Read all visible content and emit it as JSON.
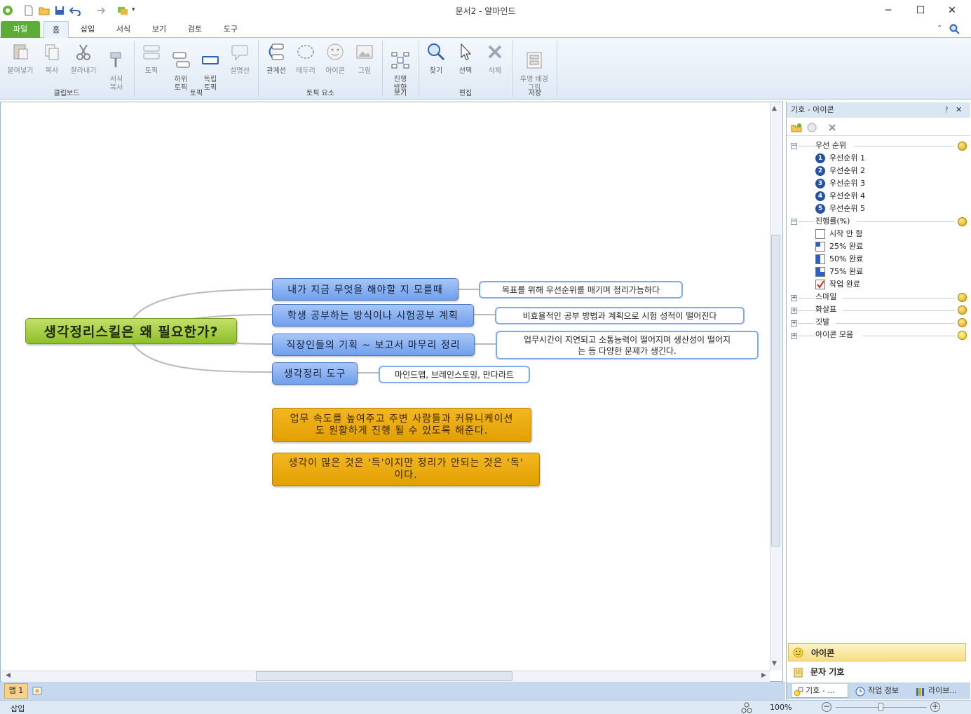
{
  "window": {
    "title": "문서2 - 알마인드",
    "minimize": "─",
    "maximize": "☐",
    "close": "✕"
  },
  "tabs": {
    "file": "파일",
    "home": "홈",
    "insert": "삽입",
    "format": "서식",
    "view": "보기",
    "review": "검토",
    "tools": "도구"
  },
  "ribbon": {
    "paste": "붙여넣기",
    "copy": "복사",
    "cut": "잘라내기",
    "format_copy": "서식\n복사",
    "clipboard_group": "클립보드",
    "topic": "토픽",
    "sub_topic": "하위\n토픽",
    "float_topic": "독립\n토픽",
    "callout": "설명선",
    "topic_group": "토픽",
    "relation": "관계선",
    "boundary": "테두리",
    "icon": "아이콘",
    "image": "그림",
    "topic_element_group": "토픽 요소",
    "direction": "진행\n방향",
    "view_group": "보기",
    "find": "찾기",
    "select": "선택",
    "delete": "삭제",
    "edit_group": "편집",
    "transparent_bg": "투명 배경\n그림",
    "save_group": "저장"
  },
  "mindmap": {
    "central": "생각정리스킬은 왜 필요한가?",
    "branches": [
      {
        "main": "내가 지금 무엇을 해야할 지 모를때",
        "sub": "목표를 위해 우선순위를 매기며 정리가능하다"
      },
      {
        "main": "학생 공부하는 방식이나 시험공부 계획",
        "sub": "비효율적인 공부 방법과 계획으로 시험 성적이 떨어진다"
      },
      {
        "main": "직장인들의 기획 ~ 보고서 마무리 정리",
        "sub": "업무시간이 지연되고 소통능력이 떨어지며 생산성이 떨어지\n는 등 다양한 문제가 생긴다."
      },
      {
        "main": "생각정리 도구",
        "sub": "마인드맵, 브레인스토밍, 만다라트"
      }
    ],
    "floating": [
      "업무 속도를 높여주고 주변 사람들과 커뮤니케이션\n도 원활하게 진행 될 수 있도록 해준다.",
      "생각이 많은 것은 '득'이지만 정리가 안되는 것은 '독'\n이다."
    ]
  },
  "page_tabs": {
    "page1": "맵 1"
  },
  "status": {
    "mode": "삽입",
    "zoom": "100%"
  },
  "panel": {
    "title": "기호 - 아이콘",
    "pin": "ᚹ",
    "close": "✕",
    "priority": {
      "label": "우선 순위",
      "items": [
        "우선순위 1",
        "우선순위 2",
        "우선순위 3",
        "우선순위 4",
        "우선순위 5"
      ],
      "numbers": [
        "1",
        "2",
        "3",
        "4",
        "5"
      ]
    },
    "progress": {
      "label": "진행률(%)",
      "items": [
        "시작 안 함",
        "25% 완료",
        "50% 완료",
        "75% 완료",
        "작업 완료"
      ]
    },
    "collapsed": [
      "스마일",
      "화살표",
      "깃발",
      "아이콘 모음"
    ],
    "sections": {
      "icon": "아이콘",
      "char": "문자 기호"
    },
    "tabs": [
      "기호 - ...",
      "작업 정보",
      "라이브..."
    ]
  },
  "colors": {
    "central_fill": "#9fcb3a",
    "main_fill": "#7fa8f0",
    "float_fill": "#e9a800",
    "file_tab": "#5cac3a"
  }
}
